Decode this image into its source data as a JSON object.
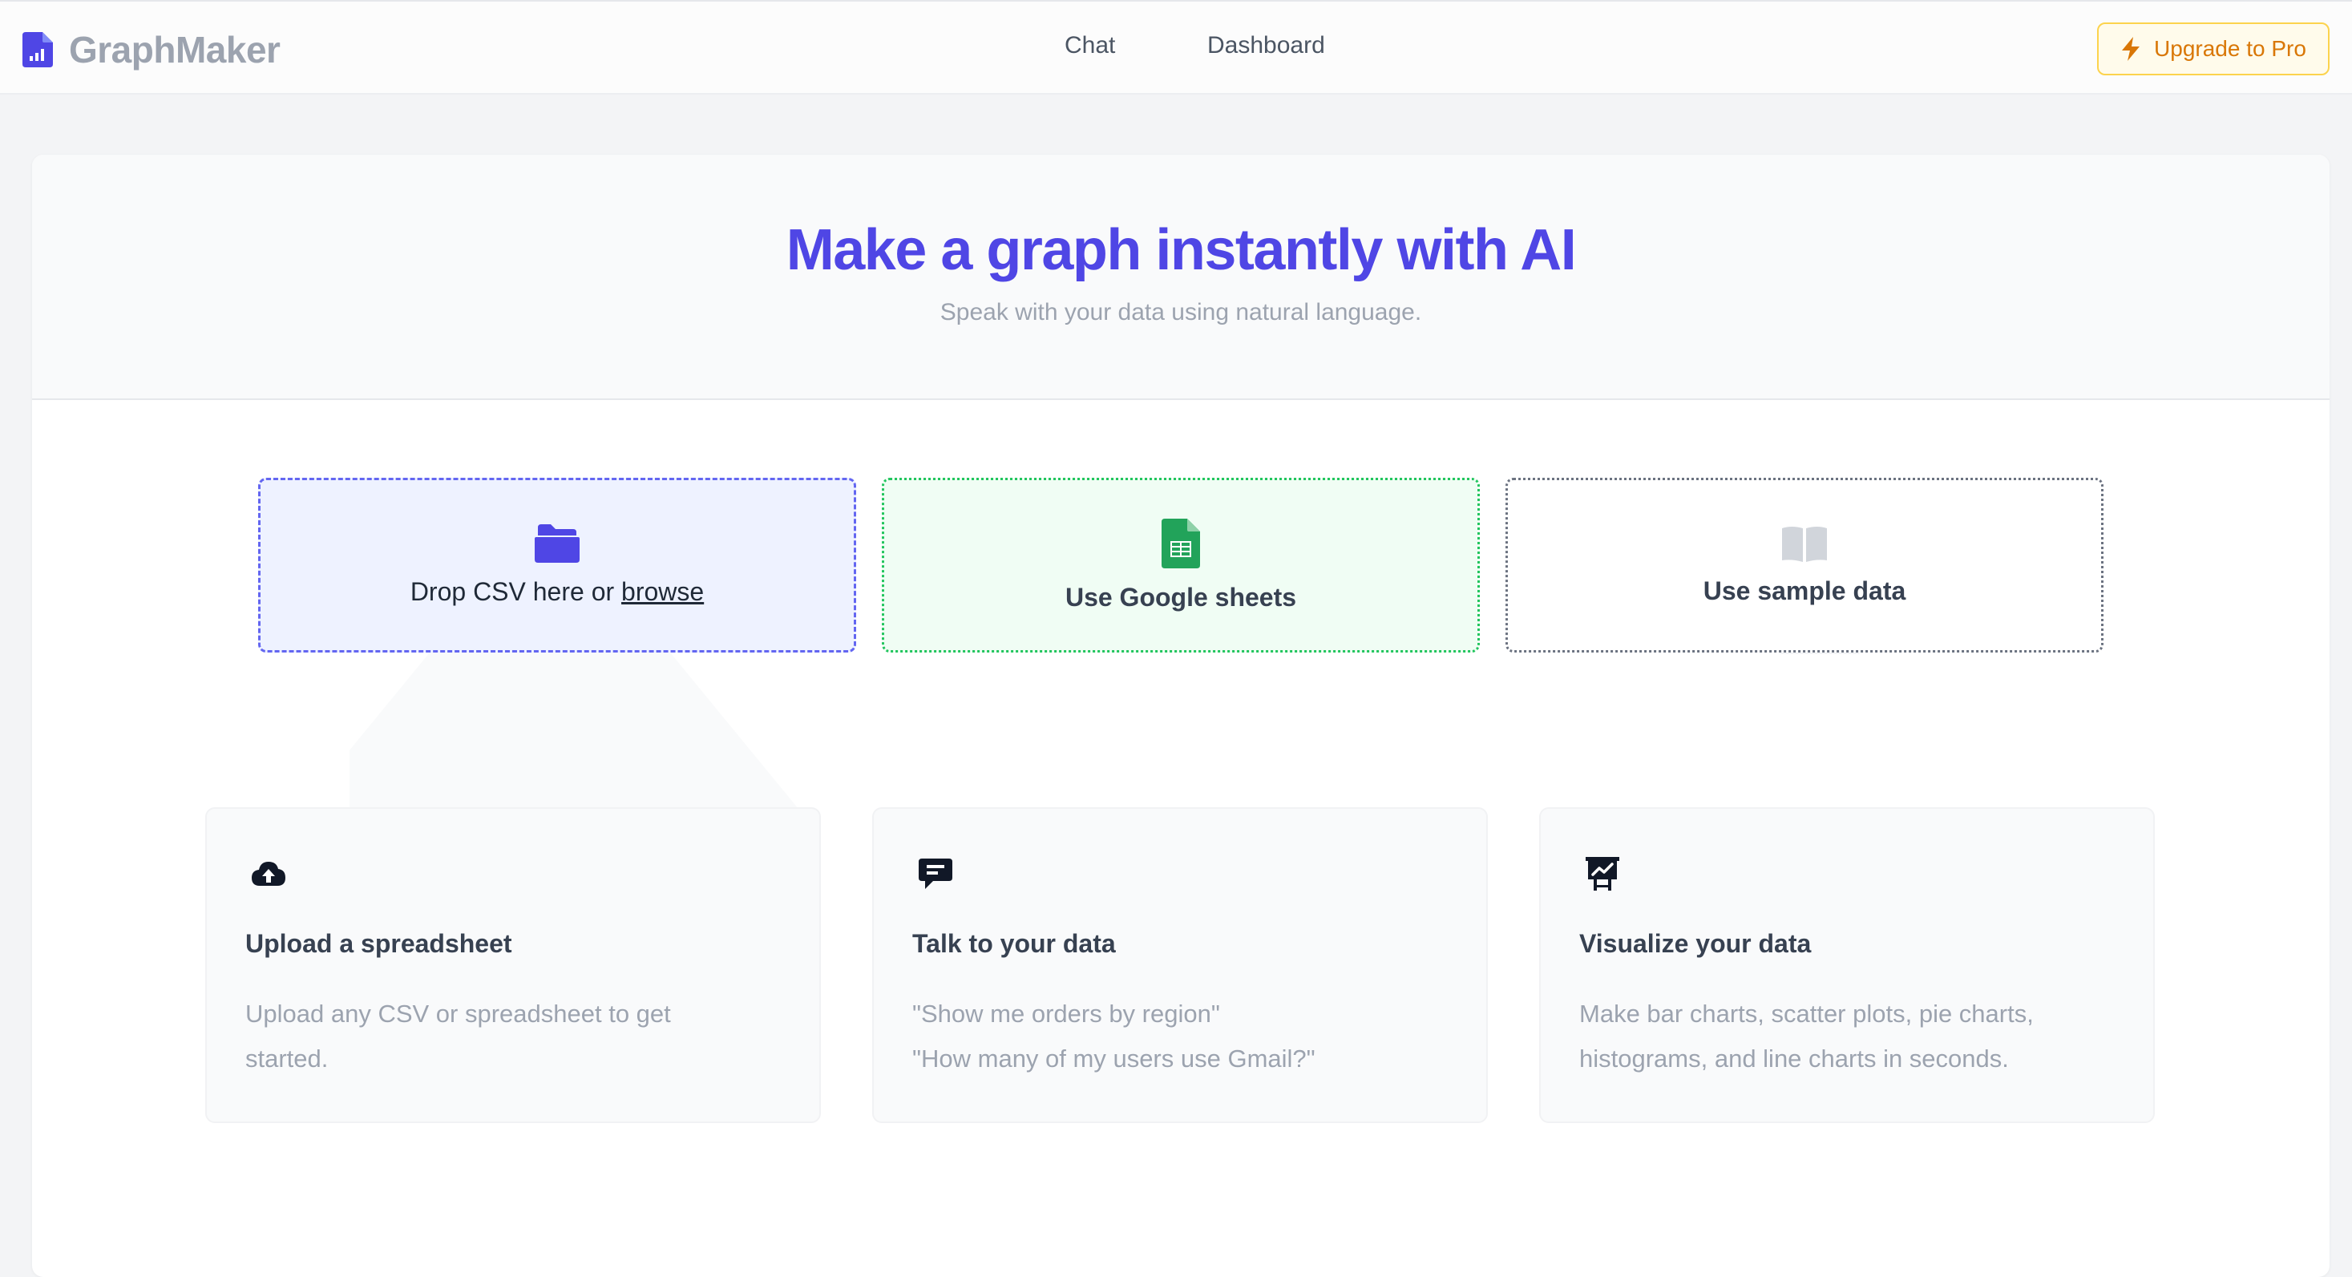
{
  "header": {
    "brand": "GraphMaker",
    "nav": {
      "chat": "Chat",
      "dashboard": "Dashboard"
    },
    "upgrade_label": "Upgrade to Pro"
  },
  "hero": {
    "title": "Make a graph instantly with AI",
    "subtitle": "Speak with your data using natural language."
  },
  "options": {
    "csv": {
      "text": "Drop CSV here or ",
      "link": "browse"
    },
    "sheets": {
      "label": "Use Google sheets"
    },
    "sample": {
      "label": "Use sample data"
    }
  },
  "features": [
    {
      "title": "Upload a spreadsheet",
      "lines": [
        "Upload any CSV or spreadsheet to get",
        "started."
      ]
    },
    {
      "title": "Talk to your data",
      "lines": [
        "\"Show me orders by region\"",
        "\"How many of my users use Gmail?\""
      ]
    },
    {
      "title": "Visualize your data",
      "lines": [
        "Make bar charts, scatter plots, pie charts,",
        "histograms, and line charts in seconds."
      ]
    }
  ],
  "colors": {
    "accent": "#4f46e5",
    "upgrade": "#d97706",
    "sheets_green": "#22c55e"
  },
  "icons": {
    "brand": "chart-document-icon",
    "upgrade": "lightning-bolt-icon",
    "csv": "folder-icon",
    "sheets": "google-sheets-icon",
    "sample": "open-book-icon",
    "feature_1": "cloud-upload-icon",
    "feature_2": "chat-bubble-icon",
    "feature_3": "presentation-chart-icon"
  }
}
